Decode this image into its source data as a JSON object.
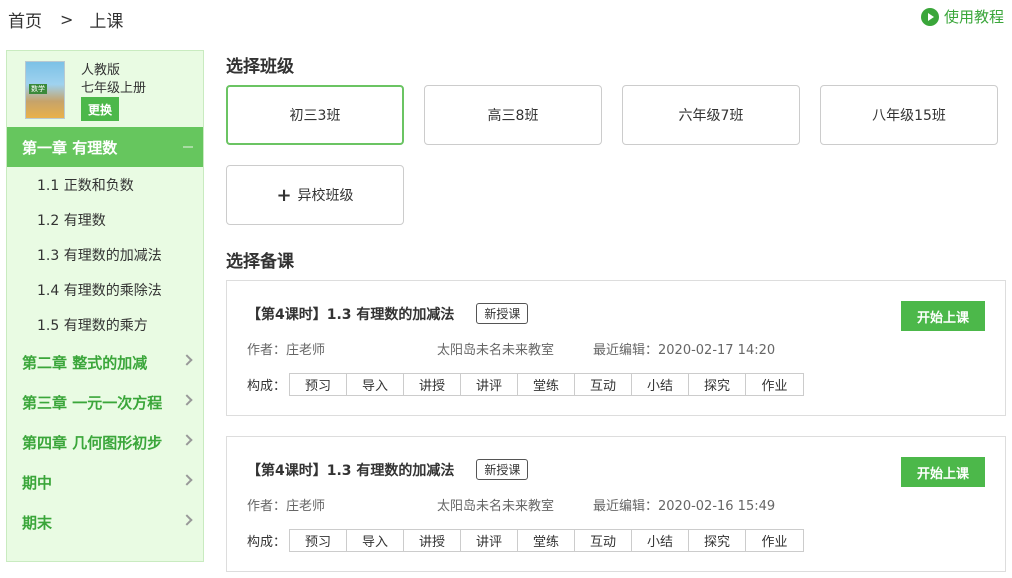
{
  "breadcrumb": {
    "home": "首页",
    "separator": ">",
    "current": "上课"
  },
  "tutorial": {
    "label": "使用教程"
  },
  "book": {
    "cover_tag": "数学",
    "publisher": "人教版",
    "grade": "七年级上册",
    "change_label": "更换"
  },
  "chapters": [
    {
      "label": "第一章 有理数",
      "active": true
    },
    {
      "label": "第二章 整式的加减"
    },
    {
      "label": "第三章 一元一次方程"
    },
    {
      "label": "第四章 几何图形初步"
    },
    {
      "label": "期中"
    },
    {
      "label": "期末"
    }
  ],
  "sections": [
    "1.1 正数和负数",
    "1.2 有理数",
    "1.3 有理数的加减法",
    "1.4 有理数的乘除法",
    "1.5 有理数的乘方"
  ],
  "class_section": {
    "title": "选择班级"
  },
  "classes": [
    "初三3班",
    "高三8班",
    "六年级7班",
    "八年级15班"
  ],
  "other_school": "异校班级",
  "lesson_section": {
    "title": "选择备课"
  },
  "lessons": [
    {
      "title": "【第4课时】1.3 有理数的加减法",
      "badge": "新授课",
      "start_label": "开始上课",
      "author": "作者：庄老师",
      "classroom": "太阳岛未名未来教室",
      "edited": "最近编辑：2020-02-17 14:20",
      "comp_label": "构成：",
      "components": [
        "预习",
        "导入",
        "讲授",
        "讲评",
        "堂练",
        "互动",
        "小结",
        "探究",
        "作业"
      ]
    },
    {
      "title": "【第4课时】1.3 有理数的加减法",
      "badge": "新授课",
      "start_label": "开始上课",
      "author": "作者：庄老师",
      "classroom": "太阳岛未名未来教室",
      "edited": "最近编辑：2020-02-16 15:49",
      "comp_label": "构成：",
      "components": [
        "预习",
        "导入",
        "讲授",
        "讲评",
        "堂练",
        "互动",
        "小结",
        "探究",
        "作业"
      ]
    }
  ],
  "colors": {
    "accent": "#4cb84a",
    "sidebar_bg": "#e9fbe3",
    "active_chapter": "#66c65e"
  }
}
